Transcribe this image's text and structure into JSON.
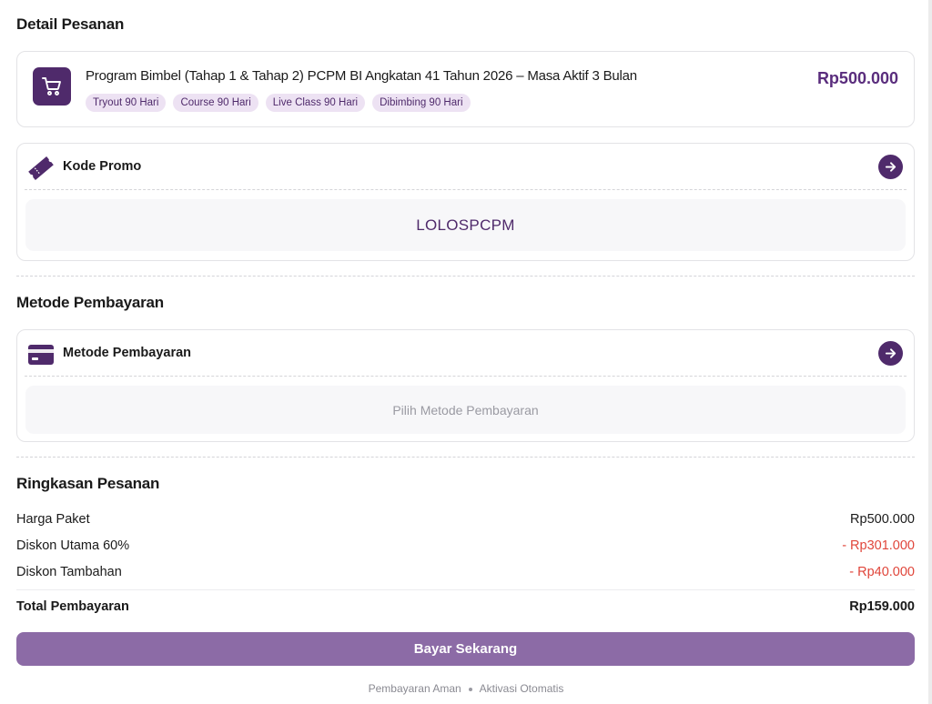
{
  "order": {
    "section_title": "Detail Pesanan",
    "product_icon": "shopping-cart-icon",
    "product_name": "Program Bimbel (Tahap 1 & Tahap 2) PCPM BI Angkatan 41 Tahun 2026 – Masa Aktif 3 Bulan",
    "tags": [
      "Tryout 90 Hari",
      "Course 90 Hari",
      "Live Class 90 Hari",
      "Dibimbing 90 Hari"
    ],
    "price": "Rp500.000"
  },
  "promo": {
    "icon": "ticket-icon",
    "label": "Kode Promo",
    "code": "LOLOSPCPM"
  },
  "payment": {
    "section_title": "Metode Pembayaran",
    "icon": "credit-card-icon",
    "label": "Metode Pembayaran",
    "placeholder": "Pilih Metode Pembayaran"
  },
  "summary": {
    "section_title": "Ringkasan Pesanan",
    "rows": [
      {
        "label": "Harga Paket",
        "value": "Rp500.000"
      },
      {
        "label": "Diskon Utama 60%",
        "value": "- Rp301.000"
      },
      {
        "label": "Diskon Tambahan",
        "value": "- Rp40.000"
      }
    ],
    "total_label": "Total Pembayaran",
    "total_value": "Rp159.000"
  },
  "pay_button_label": "Bayar Sekarang",
  "footer": {
    "left": "Pembayaran Aman",
    "right": "Aktivasi Otomatis"
  },
  "colors": {
    "primary": "#4f2a6b",
    "button": "#8c6ba6",
    "discount": "#e0453a",
    "tag_bg": "#ede2f3"
  }
}
